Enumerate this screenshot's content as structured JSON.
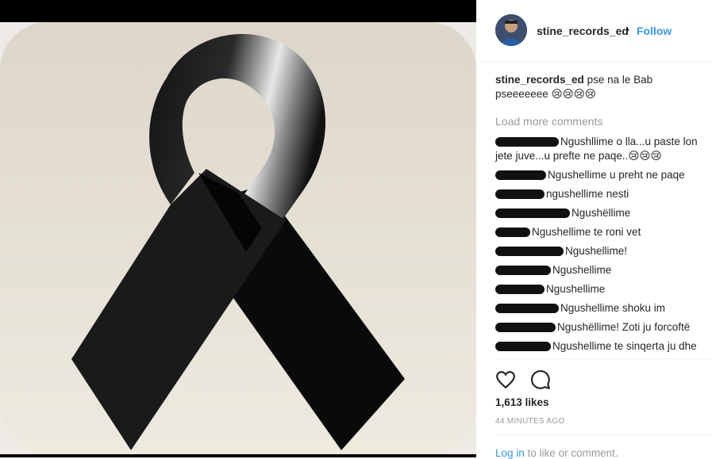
{
  "post": {
    "username": "stine_records_ed",
    "separator": "•",
    "follow_label": "Follow",
    "caption_user": "stine_records_ed",
    "caption_text": "pse na le Bab pseeeeeee 😢😢😢😢",
    "load_more": "Load more comments",
    "comments": [
      {
        "text": "Ngushllime o lla...u paste lon jete juve...u prefte ne paqe..😢😢😢"
      },
      {
        "text": "Ngushellime u preht ne paqe"
      },
      {
        "text": "ngushellime nesti"
      },
      {
        "text": "Ngushëllime"
      },
      {
        "text": "Ngushellime te roni vet"
      },
      {
        "text": "Ngushellime!"
      },
      {
        "text": "Ngushellime"
      },
      {
        "text": "Ngushellime"
      },
      {
        "text": "Ngushellime shoku im"
      },
      {
        "text": "Ngushëllime! Zoti ju forcoftë"
      },
      {
        "text": "Ngushellime te sinqerta ju dhe"
      }
    ],
    "likes": "1,613 likes",
    "time": "44 MINUTES AGO",
    "login_link": "Log in",
    "login_rest": " to like or comment."
  },
  "icons": {
    "like": "heart-icon",
    "comment": "comment-icon"
  },
  "colors": {
    "link": "#3897f0",
    "muted": "#999999",
    "text": "#262626"
  }
}
